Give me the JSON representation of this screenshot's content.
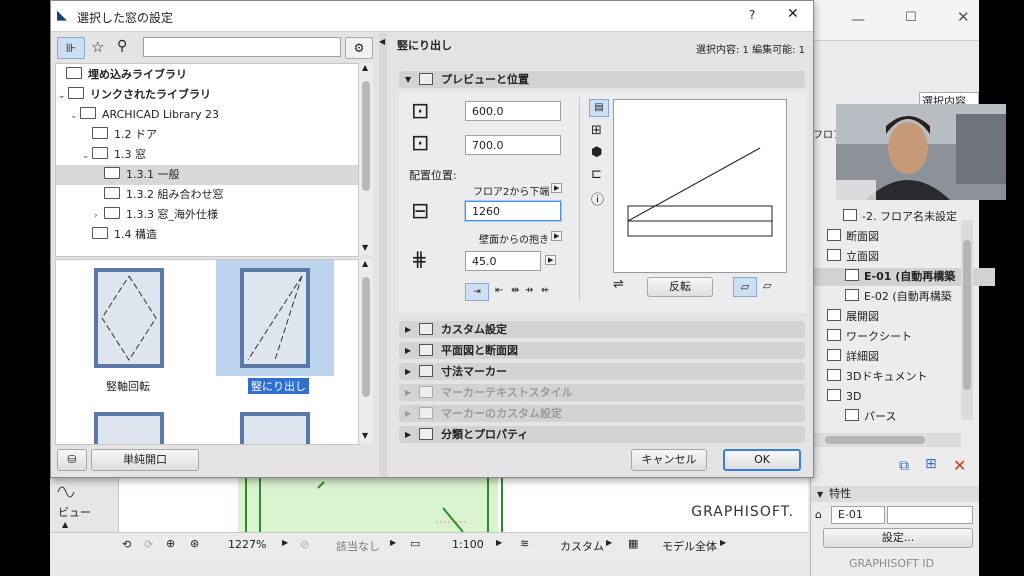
{
  "dialog": {
    "title": "選択した窓の設定",
    "help": "?",
    "close": "✕",
    "selected_name": "竪にり出し",
    "selection_info": "選択内容: 1 編集可能: 1"
  },
  "hp_toolbar": {
    "logo": "hp"
  },
  "library_tree": [
    {
      "label": "埋め込みライブラリ",
      "bold": true
    },
    {
      "label": "リンクされたライブラリ",
      "bold": true
    },
    {
      "label": "ARCHICAD Library 23"
    },
    {
      "label": "1.2 ドア"
    },
    {
      "label": "1.3 窓"
    },
    {
      "label": "1.3.1 一般"
    },
    {
      "label": "1.3.2 組み合わせ窓"
    },
    {
      "label": "1.3.3 窓_海外仕様"
    },
    {
      "label": "1.4 構造"
    }
  ],
  "thumbnails": [
    {
      "label": "竪軸回転"
    },
    {
      "label": "竪にり出し"
    }
  ],
  "left_footer": {
    "single_open": "単純開口"
  },
  "preview": {
    "section_title": "プレビューと位置",
    "width": "600.0",
    "height": "700.0",
    "placement_label": "配置位置:",
    "floor_ref": "フロア2から下端",
    "sill": "1260",
    "wall_ref": "壁面からの抱き",
    "reveal": "45.0",
    "flip": "反転"
  },
  "sections": [
    {
      "label": "カスタム設定",
      "enabled": true
    },
    {
      "label": "平面図と断面図",
      "enabled": true
    },
    {
      "label": "寸法マーカー",
      "enabled": true
    },
    {
      "label": "マーカーテキストスタイル",
      "enabled": false
    },
    {
      "label": "マーカーのカスタム設定",
      "enabled": false
    },
    {
      "label": "分類とプロパティ",
      "enabled": true
    }
  ],
  "buttons": {
    "cancel": "キャンセル",
    "ok": "OK"
  },
  "right_panel": {
    "header": "選択内容のI",
    "items": [
      {
        "label": "-2. フロア名未設定"
      },
      {
        "label": "断面図"
      },
      {
        "label": "立面図"
      },
      {
        "label": "E-01 (自動再構築"
      },
      {
        "label": "E-02 (自動再構築"
      },
      {
        "label": "展開図"
      },
      {
        "label": "ワークシート"
      },
      {
        "label": "詳細図"
      },
      {
        "label": "3Dドキュメント"
      },
      {
        "label": "3D"
      },
      {
        "label": "パース"
      }
    ],
    "properties_title": "特性",
    "id_prefix": "E-01",
    "settings": "設定...",
    "graphisoft_id": "GRAPHISOFT ID",
    "floor": "フロア"
  },
  "canvas": {
    "brand": "GRAPHISOFT.",
    "view": "ビュー"
  },
  "statusbar": {
    "zoom": "1227%",
    "none": "該当なし",
    "scale": "1:100",
    "custom": "カスタム",
    "model": "モデル全体"
  },
  "colors": {
    "accent": "#3c7fd6",
    "selection": "#bcd4ee",
    "close_red": "#d23b2f"
  }
}
